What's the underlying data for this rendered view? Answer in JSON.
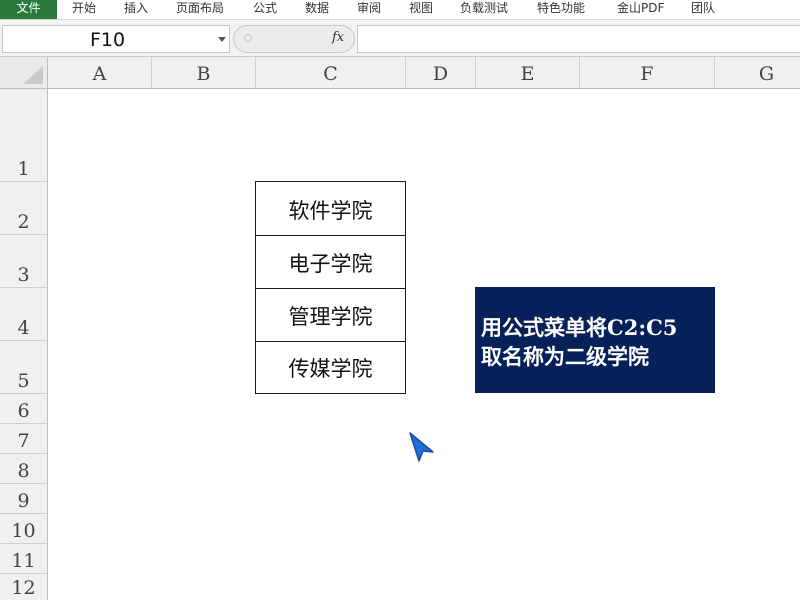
{
  "ribbon": {
    "tabs": [
      "文件",
      "开始",
      "插入",
      "页面布局",
      "公式",
      "数据",
      "审阅",
      "视图",
      "负载测试",
      "特色功能",
      "金山PDF",
      "团队"
    ]
  },
  "formula_bar": {
    "name_box": "F10",
    "fx_label": "fx",
    "formula": ""
  },
  "grid": {
    "columns": [
      "A",
      "B",
      "C",
      "D",
      "E",
      "F",
      "G"
    ],
    "rows": [
      "1",
      "2",
      "3",
      "4",
      "5",
      "6",
      "7",
      "8",
      "9",
      "10",
      "11",
      "12"
    ]
  },
  "cells": {
    "C2": "软件学院",
    "C3": "电子学院",
    "C4": "管理学院",
    "C5": "传媒学院"
  },
  "note": {
    "line1": "用公式菜单将C2:C5",
    "line2": "取名称为二级学院",
    "background": "#06205a"
  },
  "colors": {
    "file_tab": "#2a7a3c",
    "cursor": "#1f6ed4"
  }
}
